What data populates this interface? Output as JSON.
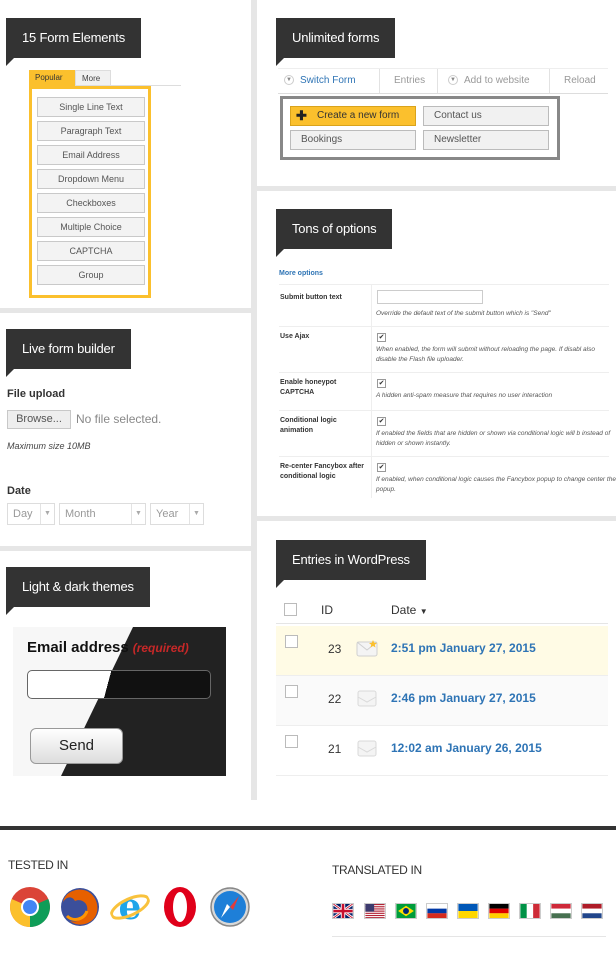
{
  "form_elements": {
    "title": "15 Form Elements",
    "tabs": [
      "Popular",
      "More"
    ],
    "items": [
      "Single Line Text",
      "Paragraph Text",
      "Email Address",
      "Dropdown Menu",
      "Checkboxes",
      "Multiple Choice",
      "CAPTCHA",
      "Group"
    ]
  },
  "unlimited_forms": {
    "title": "Unlimited forms",
    "bar": [
      "Switch Form",
      "Entries",
      "Add to website",
      "Reload"
    ],
    "buttons": [
      "Create a new form",
      "Contact us",
      "Bookings",
      "Newsletter"
    ]
  },
  "live_builder": {
    "title": "Live form builder",
    "file_label": "File upload",
    "browse": "Browse...",
    "no_file": "No file selected.",
    "max_size": "Maximum size 10MB",
    "date_label": "Date",
    "selects": [
      "Day",
      "Month",
      "Year"
    ]
  },
  "themes": {
    "title": "Light & dark themes",
    "email_label": "Email address",
    "required": "(required)",
    "send": "Send"
  },
  "options": {
    "title": "Tons of options",
    "more": "More options",
    "rows": [
      {
        "label": "Submit button text",
        "desc": "Override the default text of the submit button which is \"Send\""
      },
      {
        "label": "Use Ajax",
        "desc": "When enabled, the form will submit without reloading the page. If disabl also disable the Flash file uploader."
      },
      {
        "label": "Enable honeypot CAPTCHA",
        "desc": "A hidden anti-spam measure that requires no user interaction"
      },
      {
        "label": "Conditional logic animation",
        "desc": "If enabled the fields that are hidden or shown via conditional logic will b instead of hidden or shown instantly."
      },
      {
        "label": "Re-center Fancybox after conditional logic",
        "desc": "If enabled, when conditional logic causes the Fancybox popup to change center the popup."
      }
    ]
  },
  "entries": {
    "title": "Entries in WordPress",
    "col_id": "ID",
    "col_date": "Date",
    "rows": [
      {
        "id": "23",
        "date": "2:51 pm January 27, 2015"
      },
      {
        "id": "22",
        "date": "2:46 pm January 27, 2015"
      },
      {
        "id": "21",
        "date": "12:02 am January 26, 2015"
      }
    ]
  },
  "footer": {
    "tested": "TESTED IN",
    "translated": "TRANSLATED IN",
    "browsers": [
      "chrome-icon",
      "firefox-icon",
      "ie-icon",
      "opera-icon",
      "safari-icon"
    ],
    "flags": [
      "uk-flag",
      "us-flag",
      "brazil-flag",
      "russia-flag",
      "ukraine-flag",
      "germany-flag",
      "italy-flag",
      "hungary-flag",
      "netherlands-flag"
    ]
  },
  "colors": {
    "accent": "#fbc02d",
    "dark": "#333333",
    "link": "#2e74b5"
  }
}
